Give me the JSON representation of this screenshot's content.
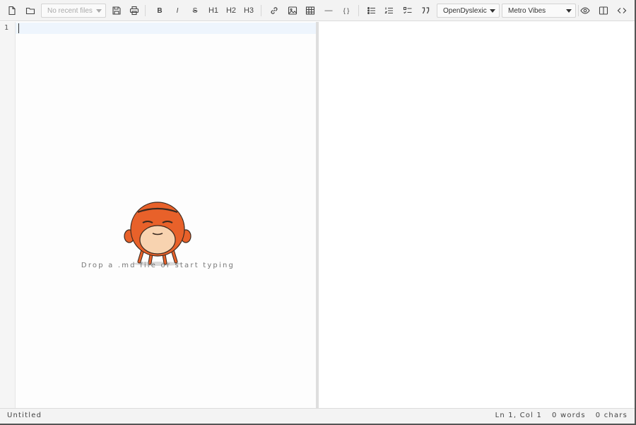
{
  "toolbar": {
    "recent_files_placeholder": "No recent files",
    "bold": "B",
    "italic": "I",
    "strike": "S",
    "h1": "H1",
    "h2": "H2",
    "h3": "H3",
    "hr": "—",
    "code": "{ }",
    "font_select": "OpenDyslexic",
    "theme_select": "Metro Vibes"
  },
  "editor": {
    "line_number": "1",
    "empty_hint": "Drop a .md file or start typing"
  },
  "status": {
    "filename": "Untitled",
    "position": "Ln 1, Col 1",
    "words": "0 words",
    "chars": "0 chars"
  },
  "colors": {
    "mascot_orange": "#e8612a",
    "mascot_face": "#f8d3b0"
  }
}
